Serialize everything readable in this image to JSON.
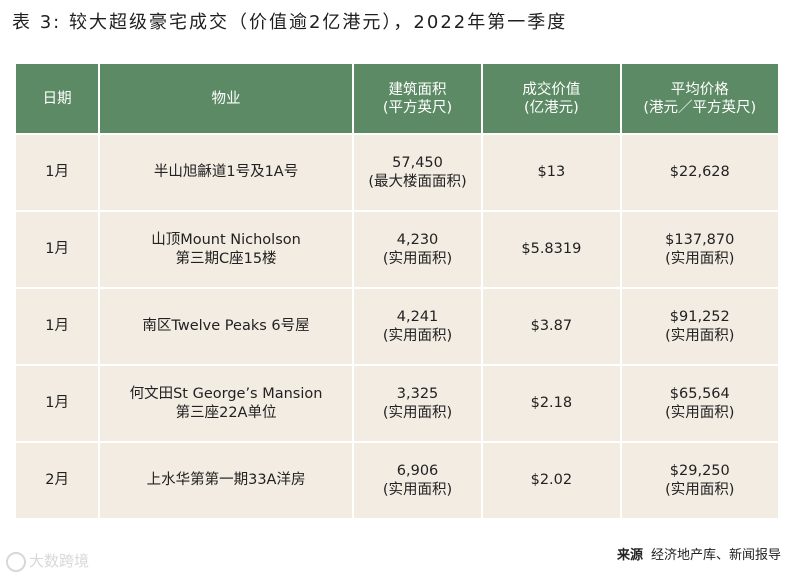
{
  "title": "表 3: 较大超级豪宅成交（价值逾2亿港元），2022年第一季度",
  "table": {
    "headers": [
      {
        "lines": [
          "日期"
        ]
      },
      {
        "lines": [
          "物业"
        ]
      },
      {
        "lines": [
          "建筑面积",
          "(平方英尺)"
        ]
      },
      {
        "lines": [
          "成交价值",
          "(亿港元)"
        ]
      },
      {
        "lines": [
          "平均价格",
          "(港元／平方英尺)"
        ]
      }
    ],
    "rows": [
      {
        "date": "1月",
        "property": [
          "半山旭龢道1号及1A号"
        ],
        "area": [
          "57,450",
          "(最大楼面面积)"
        ],
        "value": "$13",
        "price": [
          "$22,628"
        ]
      },
      {
        "date": "1月",
        "property": [
          "山顶Mount Nicholson",
          "第三期C座15楼"
        ],
        "area": [
          "4,230",
          "(实用面积)"
        ],
        "value": "$5.8319",
        "price": [
          "$137,870",
          "(实用面积)"
        ]
      },
      {
        "date": "1月",
        "property": [
          "南区Twelve Peaks 6号屋"
        ],
        "area": [
          "4,241",
          "(实用面积)"
        ],
        "value": "$3.87",
        "price": [
          "$91,252",
          "(实用面积)"
        ]
      },
      {
        "date": "1月",
        "property": [
          "何文田St George’s Mansion",
          "第三座22A单位"
        ],
        "area": [
          "3,325",
          "(实用面积)"
        ],
        "value": "$2.18",
        "price": [
          "$65,564",
          "(实用面积)"
        ]
      },
      {
        "date": "2月",
        "property": [
          "上水华第第一期33A洋房"
        ],
        "area": [
          "6,906",
          "(实用面积)"
        ],
        "value": "$2.02",
        "price": [
          "$29,250",
          "(实用面积)"
        ]
      }
    ]
  },
  "source": {
    "label": "来源",
    "text": "经济地产库、新闻报导"
  },
  "watermark": "大数跨境"
}
